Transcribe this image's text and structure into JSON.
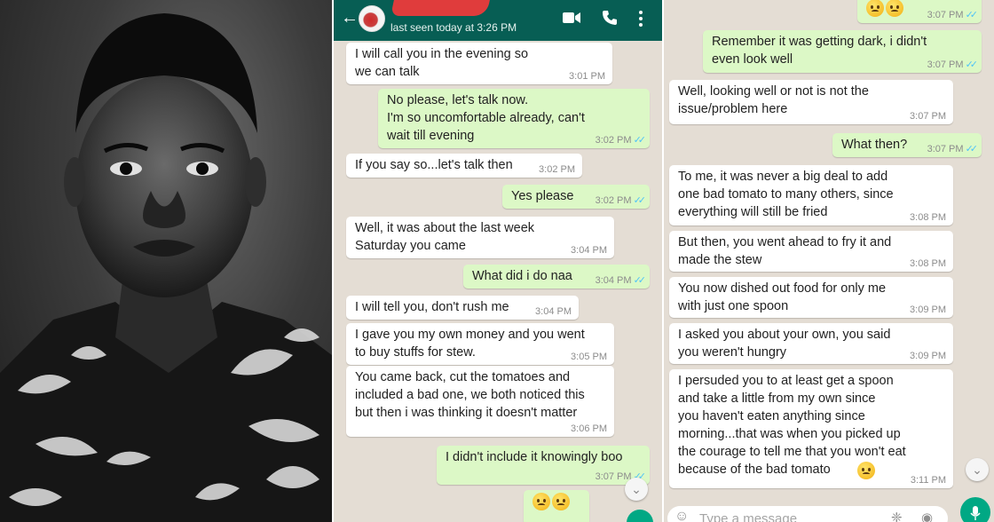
{
  "colors": {
    "header": "#075e54",
    "outgoing_bubble": "#dcf8c6",
    "incoming_bubble": "#ffffff",
    "chat_background": "#e4ddd4",
    "read_ticks": "#4fc3f7"
  },
  "header": {
    "status": "last seen today at 3:26 PM",
    "icons": [
      "back-arrow-icon",
      "video-call-icon",
      "phone-icon",
      "more-vertical-icon"
    ]
  },
  "chat_left": {
    "messages": [
      {
        "dir": "in",
        "text": "I will call you in the evening so\nwe can talk",
        "time": "3:01 PM"
      },
      {
        "dir": "out",
        "text": "No please, let's talk now.\nI'm so uncomfortable already, can't\nwait till evening",
        "time": "3:02 PM"
      },
      {
        "dir": "in",
        "text": "If you say so...let's talk then",
        "time": "3:02 PM"
      },
      {
        "dir": "out",
        "text": "Yes please",
        "time": "3:02 PM"
      },
      {
        "dir": "in",
        "text": "Well, it was about the last week\nSaturday you came",
        "time": "3:04 PM"
      },
      {
        "dir": "out",
        "text": "What did i do naa",
        "time": "3:04 PM"
      },
      {
        "dir": "in",
        "text": "I will tell you, don't rush me",
        "time": "3:04 PM"
      },
      {
        "dir": "in",
        "text": "I gave you my own money and you went\nto buy stuffs for stew.",
        "time": "3:05 PM"
      },
      {
        "dir": "in",
        "text": "You came back, cut the tomatoes and\nincluded a bad one, we both noticed this\nbut then i was thinking it doesn't matter",
        "time": "3:06 PM"
      },
      {
        "dir": "out",
        "text": "I didn't include it knowingly boo",
        "time": "3:07 PM"
      }
    ]
  },
  "chat_right": {
    "messages": [
      {
        "dir": "out",
        "text": "",
        "time": "3:07 PM"
      },
      {
        "dir": "out",
        "text": "Remember it was getting dark, i didn't\neven look well",
        "time": "3:07 PM"
      },
      {
        "dir": "in",
        "text": "Well, looking well or not is not the\nissue/problem here",
        "time": "3:07 PM"
      },
      {
        "dir": "out",
        "text": "What then?",
        "time": "3:07 PM"
      },
      {
        "dir": "in",
        "text": "To me, it was never a big deal to add\none bad tomato to many others, since\neverything will still be fried",
        "time": "3:08 PM"
      },
      {
        "dir": "in",
        "text": "But then, you went ahead to fry it and\nmade the stew",
        "time": "3:08 PM"
      },
      {
        "dir": "in",
        "text": "You now dished out food for only me\nwith just one spoon",
        "time": "3:09 PM"
      },
      {
        "dir": "in",
        "text": "I asked you about your own, you said\nyou weren't hungry",
        "time": "3:09 PM"
      },
      {
        "dir": "in",
        "text": "I persuded you to at least get a spoon\nand take a little from my own since\nyou haven't eaten anything since\nmorning...that was when you picked up\nthe courage to tell me that you won't eat\nbecause of the bad tomato",
        "time": "3:11 PM"
      }
    ]
  },
  "composer": {
    "placeholder": "Type a message"
  }
}
